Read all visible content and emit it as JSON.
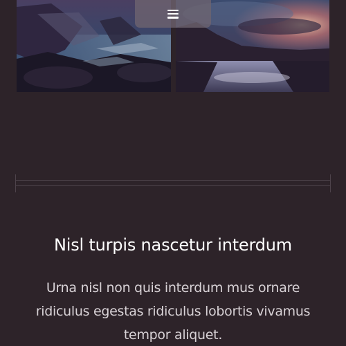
{
  "navigation": {
    "menu_icon": "menu-icon"
  },
  "gallery": {
    "images": [
      {
        "subject": "rocky shoreline at night"
      },
      {
        "subject": "lake at sunset under stormy sky"
      }
    ]
  },
  "content": {
    "headline": "Nisl turpis nascetur interdum",
    "description": "Urna nisl non quis interdum mus ornare ridiculus egestas ridiculus lobortis vivamus tempor aliquet."
  },
  "colors": {
    "background": "#2d2329",
    "headline": "#ffffff",
    "body_text": "#d8d2d6",
    "divider": "#4e434b"
  }
}
